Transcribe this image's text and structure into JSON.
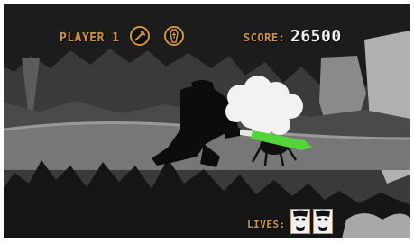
{
  "hud": {
    "player_label": "PLAYER 1",
    "score_label": "SCORE:",
    "score_value": "26500",
    "lives_label": "LIVES:",
    "lives_count": 2
  },
  "icons": {
    "weapon": "axe-icon",
    "item": "coffin-icon",
    "life": "face-portrait-icon"
  },
  "colors": {
    "hud_accent": "#d4953a",
    "score_text": "#f2f2f2",
    "blade": "#52d43a"
  }
}
